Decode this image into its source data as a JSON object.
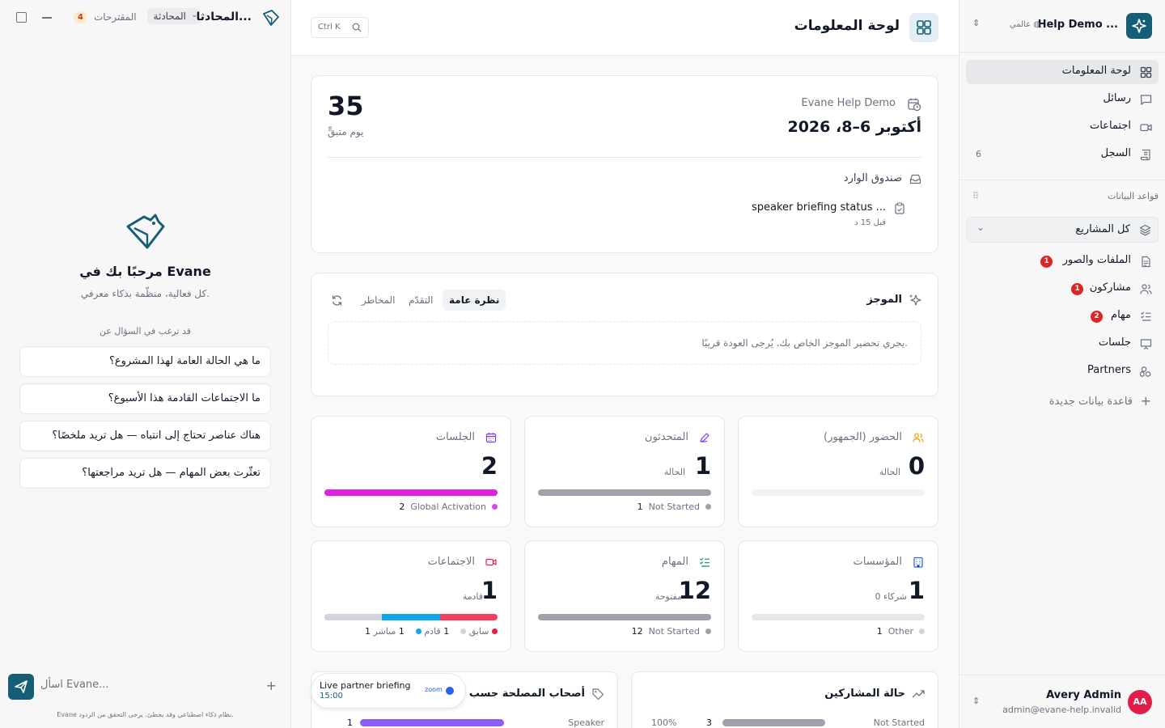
{
  "chat": {
    "title": "المحادثا...",
    "conversation_tab": "المحادثة",
    "suggestions_label": "المقترحات",
    "suggestions_count": "4",
    "welcome_title": "مرحبًا بك في Evane",
    "welcome_subtitle": "كل فعالية، منظّمة بذكاء معرفي.",
    "ask_about": "قد ترغب في السؤال عن",
    "prompts": [
      "ما هي الحالة العامة لهذا المشروع؟",
      "ما الاجتماعات القادمة هذا الأسبوع؟",
      "هناك عناصر تحتاج إلى انتباه — هل تريد ملخصًا؟",
      "تعثّرت بعض المهام — هل تريد مراجعتها؟"
    ],
    "input_placeholder": "اسأل Evane...",
    "disclaimer": "Evane نظام ذكاء اصطناعي وقد يخطئ. يرجى التحقق من الردود."
  },
  "header": {
    "title": "لوحة المعلومات",
    "search_shortcut": "Ctrl K"
  },
  "overview": {
    "days_left": "35",
    "days_left_label": "يوم متبقٍّ",
    "project_name": "Evane Help Demo",
    "date_range": "أكتوبر 6–8، 2026",
    "inbox_label": "صندوق الوارد",
    "inbox_item": "speaker briefing status ...",
    "inbox_time": "قبل 15 د"
  },
  "brief": {
    "label": "الموجز",
    "tabs": [
      "نظرة عامة",
      "التقدّم",
      "المخاطر"
    ],
    "active_tab": "نظرة عامة",
    "message": "يجري تحضير الموجز الخاص بك. يُرجى العودة قريبًا."
  },
  "stats": [
    {
      "title": "الجلسات",
      "value": "2",
      "sub": "",
      "legend": [
        {
          "count": "2",
          "label": "Global Activation",
          "color": "#d946ef"
        }
      ],
      "fill": [
        {
          "color": "#e11fe0",
          "pct": 100
        }
      ]
    },
    {
      "title": "المتحدثون",
      "value": "1",
      "sub": "الحالة",
      "legend": [
        {
          "count": "1",
          "label": "Not Started",
          "color": "#9ca3af"
        }
      ],
      "fill": [
        {
          "color": "#a1a1aa",
          "pct": 100
        }
      ]
    },
    {
      "title": "الحضور (الجمهور)",
      "value": "0",
      "sub": "الحالة",
      "legend": [],
      "fill": []
    },
    {
      "title": "الاجتماعات",
      "value": "1",
      "sub": "قادمة",
      "legend": [
        {
          "count": "1",
          "label": "سابق",
          "color": "#d1d5db"
        },
        {
          "count": "1",
          "label": "قادم",
          "color": "#0ea5e9"
        },
        {
          "count": "1",
          "label": "مباشر",
          "color": "#e11d48"
        }
      ],
      "fill": [
        {
          "color": "#d1d5db",
          "pct": 33.3
        },
        {
          "color": "#0ea5e9",
          "pct": 33.3
        },
        {
          "color": "#f43f5e",
          "pct": 33.4
        }
      ]
    },
    {
      "title": "المهام",
      "value": "12",
      "sub": "مفتوحة",
      "legend": [
        {
          "count": "12",
          "label": "Not Started",
          "color": "#9ca3af"
        }
      ],
      "fill": [
        {
          "color": "#a1a1aa",
          "pct": 100
        }
      ]
    },
    {
      "title": "المؤسسات",
      "value": "1",
      "sub": "0 شركاء",
      "legend": [
        {
          "count": "1",
          "label": "Other",
          "color": "#d1d5db"
        }
      ],
      "fill": [
        {
          "color": "#e5e7eb",
          "pct": 100
        }
      ]
    }
  ],
  "stakeholders": {
    "title": "أصحاب المصلحة حسب ال",
    "row_label": "Speaker",
    "row_count": "1"
  },
  "participants": {
    "title": "حالة المشاركين",
    "row_label": "Not Started",
    "row_count": "3",
    "row_pct": "100%"
  },
  "live": {
    "title": "Live partner briefing",
    "time": "15:00",
    "provider": "zoom"
  },
  "sidebar": {
    "workspace": "Help Demo ...",
    "scope": "عالمي",
    "nav": [
      {
        "label": "لوحة المعلومات",
        "active": true,
        "count": ""
      },
      {
        "label": "رسائل",
        "active": false,
        "count": ""
      },
      {
        "label": "اجتماعات",
        "active": false,
        "count": ""
      },
      {
        "label": "السجل",
        "active": false,
        "count": "6"
      }
    ],
    "databases_label": "قواعد البيانات",
    "all_projects": "كل المشاريع",
    "db_items": [
      {
        "label": "الملفات والصور",
        "badge": "1"
      },
      {
        "label": "مشاركون",
        "badge": "1"
      },
      {
        "label": "مهام",
        "badge": "2"
      },
      {
        "label": "جلسات",
        "badge": ""
      },
      {
        "label": "Partners",
        "badge": ""
      }
    ],
    "new_database": "قاعدة بيانات جديدة",
    "user_name": "Avery Admin",
    "user_email": "admin@evane-help.invalid",
    "user_initials": "AA"
  },
  "colors": {
    "brand": "#155e75",
    "danger": "#dc2626",
    "sessions": "#d946ef",
    "live": "#e11d48",
    "upcoming": "#0ea5e9"
  }
}
